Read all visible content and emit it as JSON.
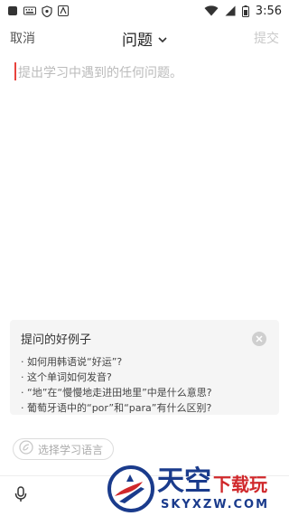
{
  "status_bar": {
    "time": "3:56",
    "icons": [
      "app-square-icon",
      "keyboard-icon",
      "shield-icon",
      "a-icon",
      "wifi-icon",
      "signal-icon",
      "battery-icon"
    ]
  },
  "header": {
    "cancel_label": "取消",
    "title": "问题",
    "submit_label": "提交"
  },
  "editor": {
    "placeholder": "提出学习中遇到的任何问题。"
  },
  "examples_card": {
    "title": "提问的好例子",
    "items": [
      "· 如何用韩语说“好运”?",
      "· 这个单词如何发音?",
      "· “地”在“慢慢地走进田地里”中是什么意思?",
      "· 葡萄牙语中的“por”和“para”有什么区别?"
    ]
  },
  "language_selector": {
    "label": "选择学习语言"
  },
  "watermark": {
    "big_text": "天空",
    "small_text": "下载玩",
    "url": "SKYXZW.COM"
  },
  "colors": {
    "caret": "#e8433d",
    "placeholder": "#bbbbbb",
    "submit_disabled": "#c9c9c9",
    "card_bg": "#f5f5f5",
    "watermark_blue": "#1a3b8c",
    "watermark_red": "#d0282b"
  }
}
